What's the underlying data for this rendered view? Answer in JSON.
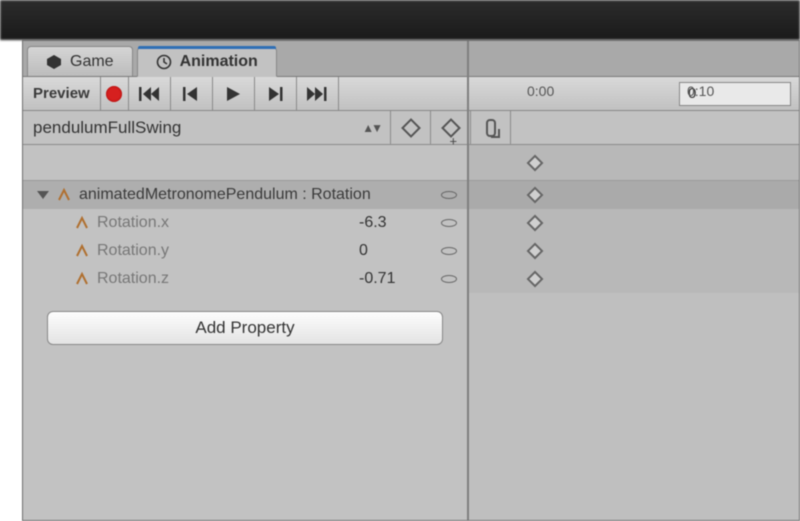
{
  "tabs": {
    "game": "Game",
    "animation": "Animation"
  },
  "toolbar": {
    "preview": "Preview",
    "frame_value": "0",
    "time_a": "0:00",
    "time_b": "0:10"
  },
  "clip": {
    "name": "pendulumFullSwing"
  },
  "properties": {
    "header": "animatedMetronomePendulum : Rotation",
    "rows": [
      {
        "label": "Rotation.x",
        "value": "-6.3"
      },
      {
        "label": "Rotation.y",
        "value": "0"
      },
      {
        "label": "Rotation.z",
        "value": "-0.71"
      }
    ],
    "add_button": "Add Property"
  }
}
